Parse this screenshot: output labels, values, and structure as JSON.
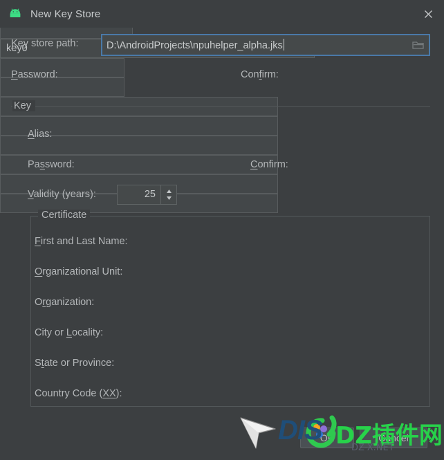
{
  "window": {
    "title": "New Key Store",
    "icon": "android-robot-icon",
    "close_label": "close-icon"
  },
  "keystore": {
    "path_label": "Key store path:",
    "path_label_mnemonic": "K",
    "path_value": "D:\\AndroidProjects\\npuhelper_alpha.jks",
    "browse_icon": "folder-icon",
    "password_label": "Password:",
    "password_mnemonic": "P",
    "password_value": "",
    "confirm_label": "Confirm:",
    "confirm_mnemonic": "f",
    "confirm_value": ""
  },
  "key_group": {
    "title": "Key",
    "alias_label": "Alias:",
    "alias_mnemonic": "A",
    "alias_value": "key0",
    "password_label": "Password:",
    "password_mnemonic": "s",
    "password_value": "",
    "confirm_label": "Confirm:",
    "confirm_mnemonic": "C",
    "confirm_value": "",
    "validity_label": "Validity (years):",
    "validity_mnemonic": "V",
    "validity_value": "25"
  },
  "certificate_group": {
    "title": "Certificate",
    "fields": [
      {
        "label": "First and Last Name:",
        "mnemonic": "F",
        "value": ""
      },
      {
        "label": "Organizational Unit:",
        "mnemonic": "O",
        "value": ""
      },
      {
        "label": "Organization:",
        "mnemonic": "r",
        "value": ""
      },
      {
        "label": "City or Locality:",
        "mnemonic": "L",
        "value": ""
      },
      {
        "label": "State or Province:",
        "mnemonic": "t",
        "value": ""
      },
      {
        "label": "Country Code (XX):",
        "mnemonic": "XX",
        "value": ""
      }
    ]
  },
  "buttons": {
    "ok_label": "OK",
    "cancel_label": "Cancel"
  },
  "watermark": {
    "brand_left": "DIS",
    "brand_right": "DZ插件网",
    "sub_text": "DZ-X.NET",
    "cursor_icon": "pointer-arrow-icon",
    "logo_icon": "dz-circle-logo-icon"
  },
  "colors": {
    "window_bg": "#3c3f41",
    "field_bg": "#45494a",
    "field_border": "#5e6364",
    "text": "#b4b7b9",
    "focus_border": "#4a79a8",
    "android_green": "#3ddc84",
    "watermark_green": "#27d24a",
    "watermark_blue": "#1f4e79"
  }
}
